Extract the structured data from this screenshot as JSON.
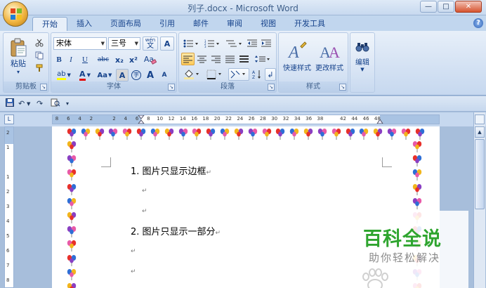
{
  "window": {
    "title": "列子.docx - Microsoft Word",
    "minimize": "—",
    "maximize": "□",
    "close": "✕"
  },
  "tabs": [
    {
      "label": "开始",
      "active": true
    },
    {
      "label": "插入",
      "active": false
    },
    {
      "label": "页面布局",
      "active": false
    },
    {
      "label": "引用",
      "active": false
    },
    {
      "label": "邮件",
      "active": false
    },
    {
      "label": "审阅",
      "active": false
    },
    {
      "label": "视图",
      "active": false
    },
    {
      "label": "开发工具",
      "active": false
    }
  ],
  "help_icon": "?",
  "ribbon": {
    "clipboard": {
      "label": "剪贴板",
      "paste": "粘贴",
      "paste_arrow": "▾"
    },
    "font": {
      "label": "字体",
      "font_name": "宋体",
      "font_size": "三号",
      "wen_label": "wén",
      "A_box": "A",
      "bold": "B",
      "italic": "I",
      "underline": "U",
      "strike": "abc",
      "subscript": "x₂",
      "superscript": "x²",
      "clear_format": "Aa",
      "highlight": "ab",
      "font_color": "A",
      "case": "Aa",
      "char_shade": "A",
      "enclose": "字",
      "grow": "A",
      "shrink": "A"
    },
    "paragraph": {
      "label": "段落"
    },
    "styles": {
      "label": "样式",
      "quick_styles": "快速样式",
      "change_styles": "更改样式"
    },
    "editing": {
      "label": "编辑"
    }
  },
  "qat": {
    "undo": "↶",
    "redo": "↷",
    "customize": "▾"
  },
  "ruler": {
    "h_labels": [
      "8",
      "6",
      "4",
      "2",
      "",
      "2",
      "4",
      "6",
      "8",
      "10",
      "12",
      "14",
      "16",
      "18",
      "20",
      "22",
      "24",
      "26",
      "28",
      "30",
      "32",
      "34",
      "36",
      "38",
      "",
      "42",
      "44",
      "46",
      "48"
    ],
    "v_labels": [
      "2",
      "1",
      "",
      "1",
      "2",
      "3",
      "4",
      "5",
      "6",
      "7",
      "8"
    ]
  },
  "document": {
    "lines": [
      {
        "text": "1. 图片只显示边框",
        "mark": "↵"
      },
      {
        "text": "",
        "mark": "↵"
      },
      {
        "text": "",
        "mark": "↵"
      },
      {
        "text": "2. 图片只显示一部分",
        "mark": "↵"
      },
      {
        "text": "",
        "mark": "↵"
      },
      {
        "text": "",
        "mark": "↵"
      }
    ]
  },
  "watermark": {
    "title": "百科全说",
    "subtitle": "助你轻松解决"
  },
  "colors": {
    "ribbon_blue": "#15428b",
    "watermark_green": "#2fa52f",
    "office_orange": "#f0b440"
  }
}
